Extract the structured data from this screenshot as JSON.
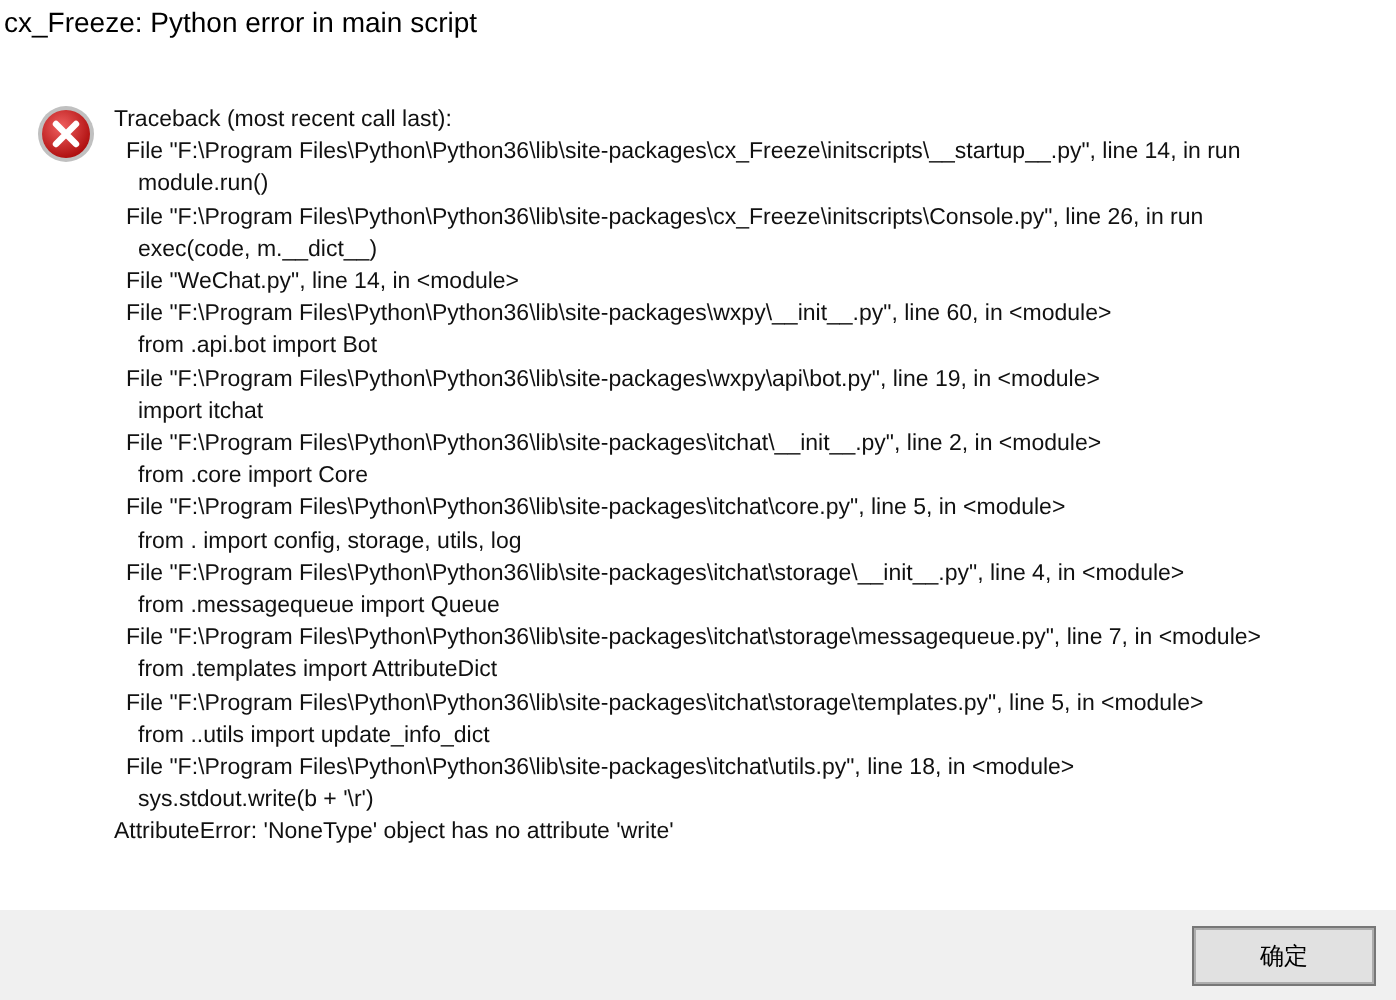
{
  "window": {
    "title": "cx_Freeze: Python error in main script"
  },
  "message": [
    {
      "kind": "header",
      "text": "Traceback (most recent call last):"
    },
    {
      "kind": "file",
      "text": "File \"F:\\Program Files\\Python\\Python36\\lib\\site-packages\\cx_Freeze\\initscripts\\__startup__.py\", line 14, in run"
    },
    {
      "kind": "code",
      "text": "module.run()"
    },
    {
      "kind": "file",
      "text": "File \"F:\\Program Files\\Python\\Python36\\lib\\site-packages\\cx_Freeze\\initscripts\\Console.py\", line 26, in run"
    },
    {
      "kind": "code",
      "text": "exec(code, m.__dict__)"
    },
    {
      "kind": "file",
      "text": "File \"WeChat.py\", line 14, in <module>"
    },
    {
      "kind": "file",
      "text": "File \"F:\\Program Files\\Python\\Python36\\lib\\site-packages\\wxpy\\__init__.py\", line 60, in <module>"
    },
    {
      "kind": "code",
      "text": "from .api.bot import Bot"
    },
    {
      "kind": "file",
      "text": "File \"F:\\Program Files\\Python\\Python36\\lib\\site-packages\\wxpy\\api\\bot.py\", line 19, in <module>"
    },
    {
      "kind": "code",
      "text": "import itchat"
    },
    {
      "kind": "file",
      "text": "File \"F:\\Program Files\\Python\\Python36\\lib\\site-packages\\itchat\\__init__.py\", line 2, in <module>"
    },
    {
      "kind": "code",
      "text": "from .core import Core"
    },
    {
      "kind": "file",
      "text": "File \"F:\\Program Files\\Python\\Python36\\lib\\site-packages\\itchat\\core.py\", line 5, in <module>"
    },
    {
      "kind": "code",
      "text": "from . import config, storage, utils, log"
    },
    {
      "kind": "file",
      "text": "File \"F:\\Program Files\\Python\\Python36\\lib\\site-packages\\itchat\\storage\\__init__.py\", line 4, in <module>"
    },
    {
      "kind": "code",
      "text": "from .messagequeue import Queue"
    },
    {
      "kind": "file",
      "text": "File \"F:\\Program Files\\Python\\Python36\\lib\\site-packages\\itchat\\storage\\messagequeue.py\", line 7, in <module>"
    },
    {
      "kind": "code",
      "text": "from .templates import AttributeDict"
    },
    {
      "kind": "file",
      "text": "File \"F:\\Program Files\\Python\\Python36\\lib\\site-packages\\itchat\\storage\\templates.py\", line 5, in <module>"
    },
    {
      "kind": "code",
      "text": "from ..utils import update_info_dict"
    },
    {
      "kind": "file",
      "text": "File \"F:\\Program Files\\Python\\Python36\\lib\\site-packages\\itchat\\utils.py\", line 18, in <module>"
    },
    {
      "kind": "code",
      "text": "sys.stdout.write(b + '\\r')"
    },
    {
      "kind": "header",
      "text": "AttributeError: 'NoneType' object has no attribute 'write'"
    }
  ],
  "buttons": [
    {
      "label": "确定"
    }
  ]
}
